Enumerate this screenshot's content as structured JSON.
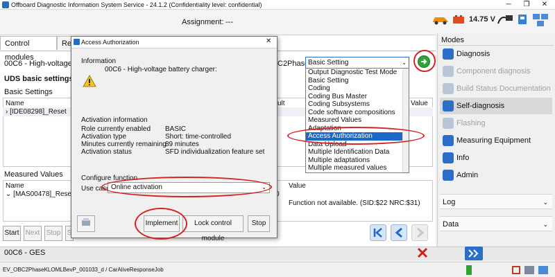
{
  "window": {
    "title": "Offboard Diagnostic Information System Service - 24.1.2 (Confidentiality level: confidential)"
  },
  "header": {
    "assignment_label": "Assignment:",
    "assignment_value": "---",
    "voltage": "14.75 V"
  },
  "left": {
    "tabs": [
      "Control modules",
      "Re"
    ],
    "module_field": "00C6 - High-voltage I",
    "module_field_tail": "C2Phase",
    "heading": "UDS basic settings",
    "basic_settings_label": "Basic Settings",
    "col_name": "Name",
    "col_result": "ult",
    "col_value": "Value",
    "basic_row": "[IDE08298]_Reset",
    "measured_values_label": "Measured Values",
    "measured_col_name": "Name",
    "measured_col_value": "Value",
    "measured_row": "[MAS00478]_Rese",
    "measured_row_num": "0",
    "measured_row_value": "Function not available. (SID:$22 NRC:$31)",
    "buttons": [
      "Start",
      "Next",
      "Stop",
      "S"
    ],
    "bottom_module": "00C6 - GES"
  },
  "mode_dropdown": {
    "selected": "Basic Setting",
    "options": [
      "Output Diagnostic Test Mode",
      "Basic Setting",
      "Coding",
      "Coding Bus Master",
      "Coding Subsystems",
      "Code software compositions",
      "Measured Values",
      "Adaptation",
      "Access Authorization",
      "Data Upload",
      "Multiple Identification Data",
      "Multiple adaptations",
      "Multiple measured values"
    ],
    "highlighted": "Access Authorization"
  },
  "dialog": {
    "title": "Access Authorization",
    "info_label": "Information",
    "info_text": "00C6 - High-voltage battery charger:",
    "activation_label": "Activation information",
    "rows": [
      {
        "k": "Role currently enabled",
        "v": "BASIC"
      },
      {
        "k": "Activation type",
        "v": "Short: time-controlled"
      },
      {
        "k": "Minutes currently remaining",
        "v": "89 minutes"
      },
      {
        "k": "Activation status",
        "v": "SFD individualization feature set"
      }
    ],
    "configure_label": "Configure function",
    "use_case_label": "Use case",
    "use_case_value": "Online activation",
    "buttons": {
      "implement": "Implement",
      "lock": "Lock control module",
      "stop": "Stop"
    }
  },
  "modes": {
    "title": "Modes",
    "items": [
      {
        "label": "Diagnosis",
        "disabled": false,
        "active": false,
        "color": "#2b6fc8"
      },
      {
        "label": "Component diagnosis",
        "disabled": true,
        "active": false,
        "color": "#a7b9cf"
      },
      {
        "label": "Build Status Documentation",
        "disabled": true,
        "active": false,
        "color": "#a7b9cf"
      },
      {
        "label": "Self-diagnosis",
        "disabled": false,
        "active": true,
        "color": "#2b6fc8"
      },
      {
        "label": "Flashing",
        "disabled": true,
        "active": false,
        "color": "#a7b9cf"
      },
      {
        "label": "Measuring Equipment",
        "disabled": false,
        "active": false,
        "color": "#2b6fc8"
      },
      {
        "label": "Info",
        "disabled": false,
        "active": false,
        "color": "#2b6fc8"
      },
      {
        "label": "Admin",
        "disabled": false,
        "active": false,
        "color": "#2b6fc8"
      }
    ],
    "log_label": "Log",
    "data_label": "Data"
  },
  "status_bar": {
    "path": "EV_OBC2PhaseKLOMLBevP_001033_d / CarAliveResponseJob"
  },
  "colors": {
    "accent": "#1b68c6",
    "highlight_red": "#d32424",
    "go_green": "#2fa23a",
    "stop_red": "#cc2020"
  }
}
